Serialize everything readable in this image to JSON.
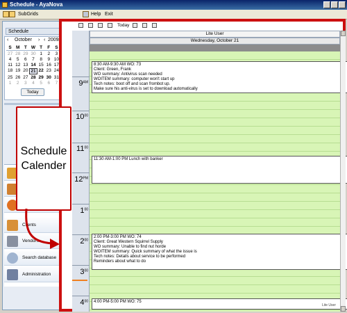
{
  "window": {
    "title": "Schedule - AyaNova"
  },
  "menu": {
    "subgrids": "SubGrids",
    "help": "Help",
    "exit": "Exit"
  },
  "sidebar": {
    "header": "Schedule",
    "calendar": {
      "month": "October",
      "year": "2009",
      "dow": [
        "S",
        "M",
        "T",
        "W",
        "T",
        "F",
        "S"
      ],
      "weeks": [
        [
          "27",
          "28",
          "29",
          "30",
          "1",
          "2",
          "3"
        ],
        [
          "4",
          "5",
          "6",
          "7",
          "8",
          "9",
          "10"
        ],
        [
          "11",
          "12",
          "13",
          "14",
          "15",
          "16",
          "17"
        ],
        [
          "18",
          "19",
          "20",
          "21",
          "22",
          "23",
          "24"
        ],
        [
          "25",
          "26",
          "27",
          "28",
          "29",
          "30",
          "31"
        ],
        [
          "1",
          "2",
          "3",
          "4",
          "5",
          "6",
          "7"
        ]
      ],
      "today_label": "Today"
    },
    "nav": [
      {
        "label": "Clients",
        "icon": "house-icon"
      },
      {
        "label": "Vendors",
        "icon": "truck-icon"
      },
      {
        "label": "Search database",
        "icon": "magnifier-icon"
      },
      {
        "label": "Administration",
        "icon": "admin-gear-icon"
      }
    ]
  },
  "callout": {
    "line1": "Schedule",
    "line2": "Calender"
  },
  "schedule": {
    "toolbar_today": "Today",
    "resource": "Lite User",
    "date": "Wednesday, October 21",
    "hours": [
      {
        "n": "9",
        "s": "AM"
      },
      {
        "n": "10",
        "s": "00"
      },
      {
        "n": "11",
        "s": "00"
      },
      {
        "n": "12",
        "s": "PM"
      },
      {
        "n": "1",
        "s": "00"
      },
      {
        "n": "2",
        "s": "00"
      },
      {
        "n": "3",
        "s": "00"
      },
      {
        "n": "4",
        "s": "00"
      }
    ],
    "appointments": [
      {
        "lines": [
          "8:30 AM-9:30 AM WO: 73",
          "Client:  Green, Frank",
          "WO summary: Antivirus scan needed",
          "WOITEM summary: computer won't start up",
          "Tech notes: boot off and scan frombot up.",
          "Make sure his anti-virus is set to download automatically"
        ]
      },
      {
        "lines": [
          "11:30 AM-1:00 PM Lunch with banker"
        ]
      },
      {
        "lines": [
          "2:00 PM-3:00 PM WO: 74",
          "Client:  Great Western Squirrel Supply",
          "WO summary: Unable to find nut horde",
          "WOITEM summary: Quick summary of what the issue is",
          "Tech notes: Details about service to be performed",
          "Reminders about what to do"
        ]
      },
      {
        "lines": [
          "4:00 PM-5:00 PM WO: 75"
        ]
      }
    ],
    "status": "Lite User"
  },
  "colors": {
    "frame": "#cc1010",
    "grid": "#d8f5b6",
    "accent": "#f08020"
  }
}
